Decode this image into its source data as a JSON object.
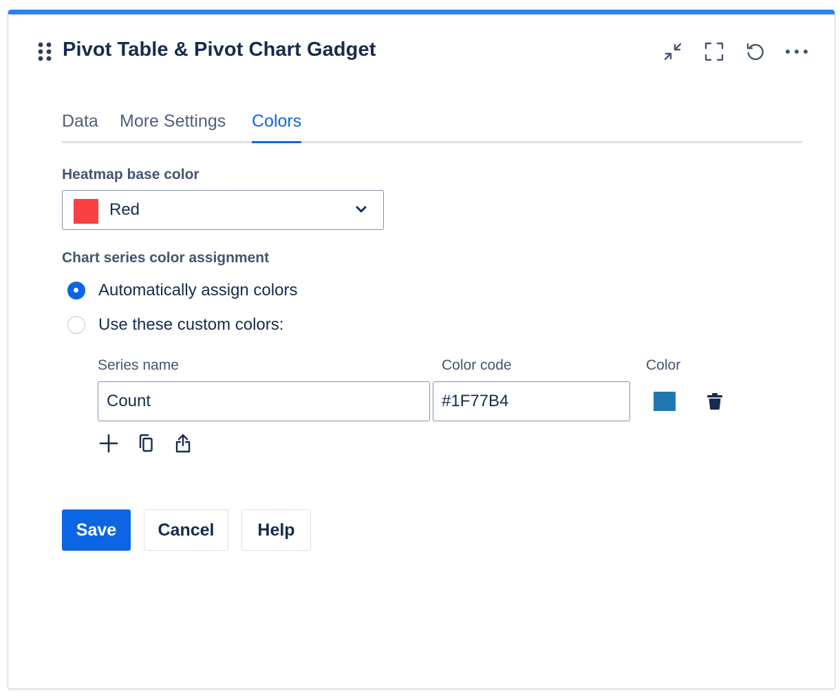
{
  "gadget": {
    "title": "Pivot Table & Pivot Chart Gadget",
    "accent_color": "#2684ff",
    "header_icons": [
      "minimize-icon",
      "fullscreen-icon",
      "refresh-icon",
      "more-icon"
    ]
  },
  "tabs": [
    {
      "label": "Data",
      "active": false
    },
    {
      "label": "More Settings",
      "active": false
    },
    {
      "label": "Colors",
      "active": true
    }
  ],
  "heatmap": {
    "label": "Heatmap base color",
    "selected": "Red",
    "swatch_color": "#f94144"
  },
  "series_assignment": {
    "label": "Chart series color assignment",
    "options": [
      {
        "label": "Automatically assign colors",
        "checked": true
      },
      {
        "label": "Use these custom colors:",
        "checked": false
      }
    ]
  },
  "custom_colors": {
    "headers": {
      "series_name": "Series name",
      "color_code": "Color code",
      "color": "Color"
    },
    "rows": [
      {
        "series_name": "Count",
        "color_code": "#1F77B4",
        "color": "#1f77b4"
      }
    ],
    "row_actions": [
      "add-icon",
      "copy-icon",
      "share-icon"
    ]
  },
  "buttons": {
    "save": "Save",
    "cancel": "Cancel",
    "help": "Help",
    "primary_color": "#0c66e4"
  }
}
